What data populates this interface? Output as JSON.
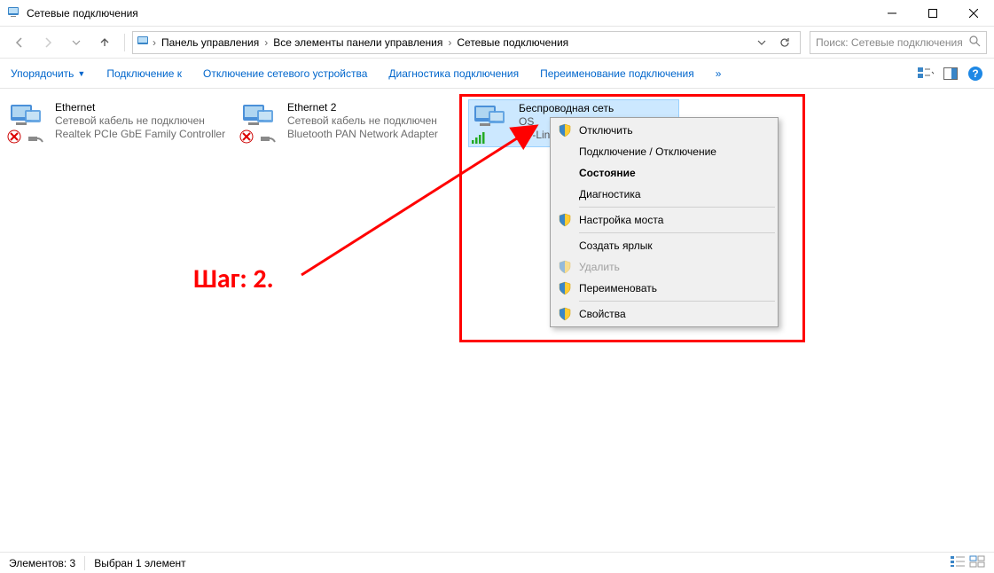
{
  "window": {
    "title": "Сетевые подключения"
  },
  "breadcrumbs": {
    "c1": "Панель управления",
    "c2": "Все элементы панели управления",
    "c3": "Сетевые подключения"
  },
  "search": {
    "placeholder": "Поиск: Сетевые подключения"
  },
  "toolbar": {
    "organize": "Упорядочить",
    "connect": "Подключение к",
    "disable": "Отключение сетевого устройства",
    "diagnose": "Диагностика подключения",
    "rename": "Переименование подключения",
    "overflow": "»"
  },
  "connections": [
    {
      "name": "Ethernet",
      "status": "Сетевой кабель не подключен",
      "device": "Realtek PCIe GbE Family Controller",
      "disconnected": true,
      "selected": false,
      "wifi": false
    },
    {
      "name": "Ethernet 2",
      "status": "Сетевой кабель не подключен",
      "device": "Bluetooth PAN Network Adapter",
      "disconnected": true,
      "selected": false,
      "wifi": false
    },
    {
      "name": "Беспроводная сеть",
      "status": "OS",
      "device": "TP-Link",
      "disconnected": false,
      "selected": true,
      "wifi": true
    }
  ],
  "contextMenu": {
    "disable": "Отключить",
    "connectDisconnect": "Подключение / Отключение",
    "status": "Состояние",
    "diagnostics": "Диагностика",
    "bridge": "Настройка моста",
    "shortcut": "Создать ярлык",
    "delete": "Удалить",
    "renameItem": "Переименовать",
    "properties": "Свойства"
  },
  "annotation": {
    "label": "Шаг: 2."
  },
  "statusbar": {
    "count": "Элементов: 3",
    "selected": "Выбран 1 элемент"
  }
}
